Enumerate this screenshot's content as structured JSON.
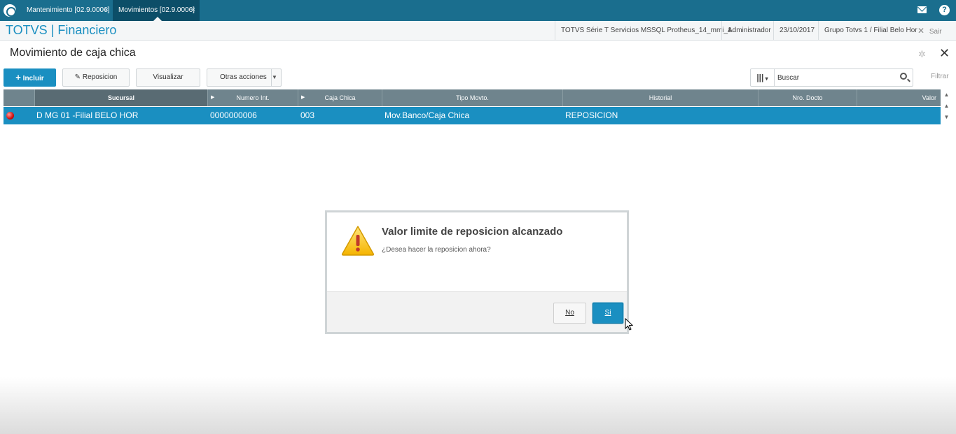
{
  "topbar": {
    "tabs": [
      {
        "label": "Mantenimiento [02.9.0006]",
        "close": "×"
      },
      {
        "label": "Movimientos [02.9.0006]",
        "close": "×"
      }
    ]
  },
  "header": {
    "brand": "TOTVS | Financiero",
    "environment": "TOTVS Série T Servicios MSSQL Protheus_14_mmi_1",
    "user": "Administrador",
    "date": "23/10/2017",
    "group": "Grupo Totvs 1 / Filial Belo Hor",
    "exit_label": "Sair"
  },
  "page": {
    "title": "Movimiento de caja chica"
  },
  "toolbar": {
    "include_label": "Incluir",
    "reposicion_label": "Reposicion",
    "visualizar_label": "Visualizar",
    "otras_label": "Otras acciones",
    "search_placeholder": "Buscar",
    "filter_label": "Filtrar"
  },
  "grid": {
    "columns": [
      "Sucursal",
      "Numero Int.",
      "Caja Chica",
      "Tipo Movto.",
      "Historial",
      "Nro. Docto",
      "Valor"
    ],
    "rows": [
      {
        "status_color": "#d01010",
        "sucursal": "D MG 01 -Filial BELO HOR",
        "numero_int": "0000000006",
        "caja_chica": "003",
        "tipo_movto": "Mov.Banco/Caja Chica",
        "historial": "REPOSICION",
        "nro_docto": "",
        "valor": ""
      }
    ]
  },
  "dialog": {
    "title": "Valor limite de reposicion alcanzado",
    "message": "¿Desea hacer la reposicion ahora?",
    "no_label": "No",
    "si_label": "Si"
  }
}
